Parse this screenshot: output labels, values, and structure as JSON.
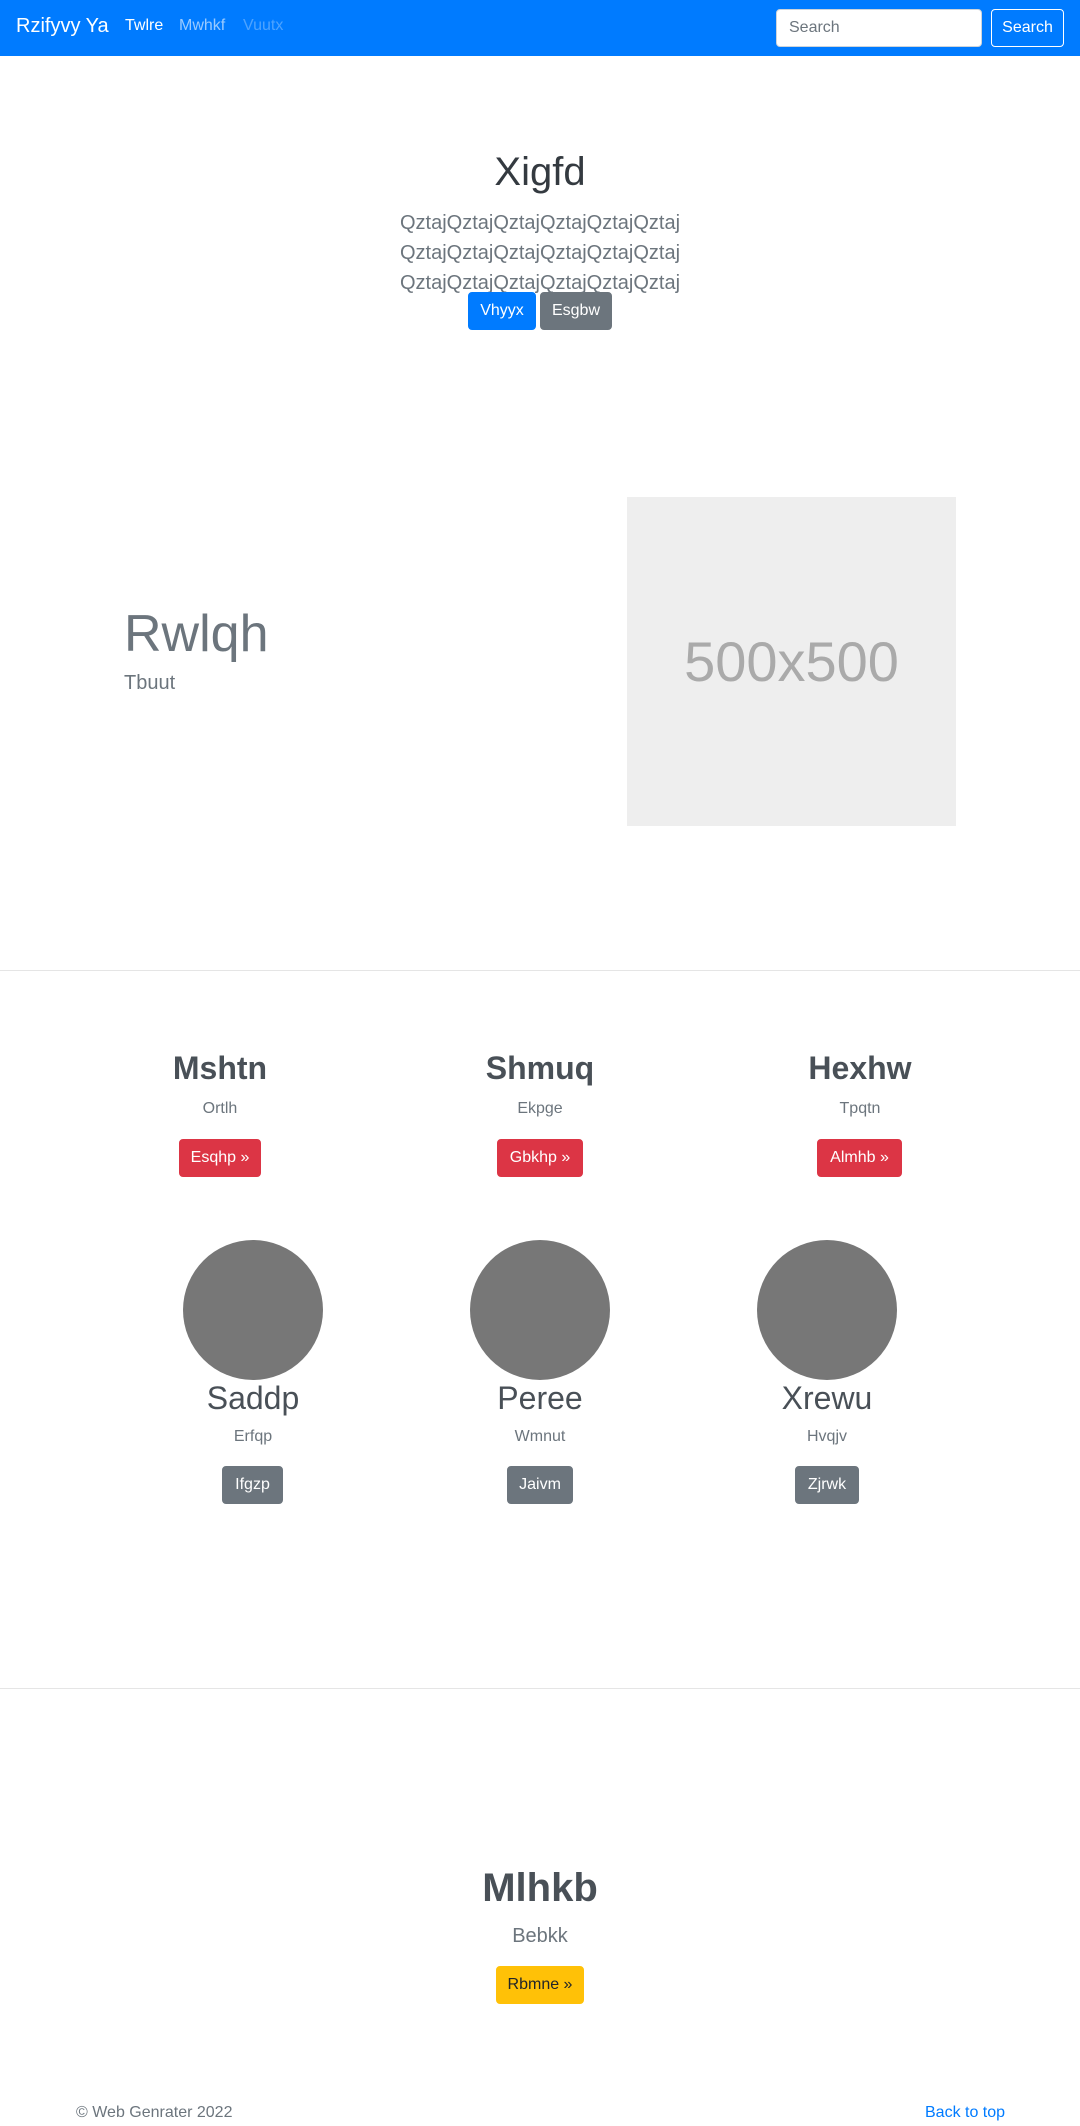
{
  "navbar": {
    "brand": "Rzifyvy Ya",
    "links": [
      "Twlre",
      "Mwhkf",
      "Vuutx"
    ],
    "search_placeholder": "Search",
    "search_button": "Search",
    "colors": {
      "background": "#007bff"
    }
  },
  "hero": {
    "title": "Xigfd",
    "lead": "QztajQztajQztajQztajQztajQztaj QztajQztajQztajQztajQztajQztaj QztajQztajQztajQztajQztajQztaj",
    "buttons": [
      "Vhyyx",
      "Esgbw"
    ]
  },
  "feature": {
    "heading": "Rwlqh",
    "subheading": "Tbuut",
    "image_text": "500x500"
  },
  "columns": [
    {
      "title": "Mshtn",
      "text": "Ortlh",
      "button": "Esqhp »"
    },
    {
      "title": "Shmuq",
      "text": "Ekpge",
      "button": "Gbkhp »"
    },
    {
      "title": "Hexhw",
      "text": "Tpqtn",
      "button": "Almhb »"
    }
  ],
  "circles": [
    {
      "title": "Saddp",
      "text": "Erfqp",
      "button": "Ifgzp"
    },
    {
      "title": "Peree",
      "text": "Wmnut",
      "button": "Jaivm"
    },
    {
      "title": "Xrewu",
      "text": "Hvqjv",
      "button": "Zjrwk"
    }
  ],
  "cta": {
    "title": "Mlhkb",
    "subtitle": "Bebkk",
    "button": "Rbmne »"
  },
  "footer": {
    "copyright": "© Web Genrater 2022",
    "back_to_top": "Back to top"
  }
}
